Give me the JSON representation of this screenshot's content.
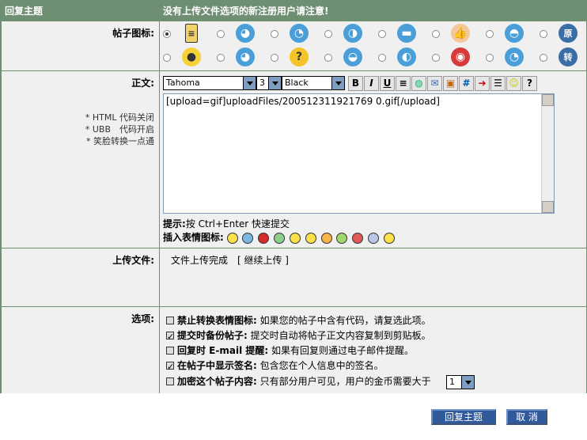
{
  "header": {
    "left": "回复主题",
    "right": "没有上传文件选项的新注册用户请注意!"
  },
  "post_icon": {
    "label": "帖子图标:"
  },
  "body": {
    "label": "正文:",
    "notes": [
      "* HTML 代码关闭",
      "* UBB　代码开启",
      "* 笑脸转换一点通"
    ],
    "font": "Tahoma",
    "size": "3",
    "color": "Black",
    "content": "[upload=gif]uploadFiles/200512311921769 0.gif[/upload]",
    "hint_label": "提示:",
    "hint_text": "按 Ctrl+Enter 快速提交",
    "emoticon_label": "插入表情图标:"
  },
  "upload": {
    "label": "上传文件:",
    "status": "文件上传完成",
    "continue": "[ 继续上传 ]"
  },
  "options": {
    "label": "选项:",
    "items": [
      {
        "title": "禁止转换表情图标:",
        "desc": "如果您的帖子中含有代码，请复选此项。",
        "checked": false
      },
      {
        "title": "提交时备份帖子:",
        "desc": "提交时自动将帖子正文内容复制到剪贴板。",
        "checked": true
      },
      {
        "title": "回复时 E-mail 提醒:",
        "desc": "如果有回复则通过电子邮件提醒。",
        "checked": false
      },
      {
        "title": "在帖子中显示签名:",
        "desc": "包含您在个人信息中的签名。",
        "checked": true
      },
      {
        "title": "加密这个帖子内容:",
        "desc": "只有部分用户可见，用户的金币需要大于",
        "checked": false
      }
    ],
    "coin_value": "1"
  },
  "buttons": {
    "submit": "回复主题",
    "cancel": "取 消"
  }
}
